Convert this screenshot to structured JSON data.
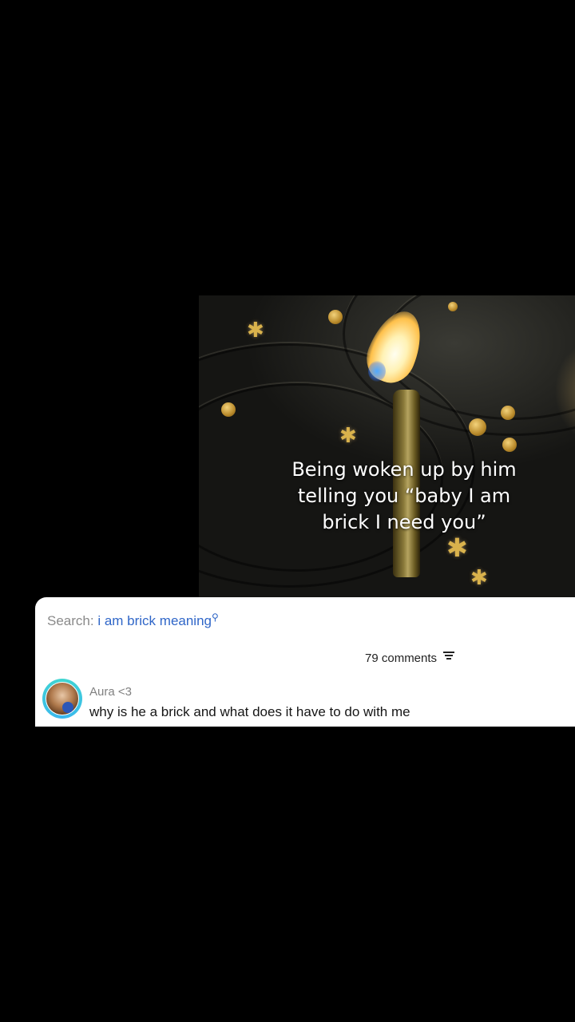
{
  "video": {
    "caption_lines": [
      "Being woken up by him",
      "telling you “baby I am",
      "brick I need you”"
    ]
  },
  "comments_panel": {
    "search_prefix": "Search:",
    "search_query": "i am brick meaning",
    "search_icon": "search-icon",
    "comment_count": "79 comments",
    "filter_icon": "filter-icon",
    "comments": [
      {
        "username": "Aura <3",
        "text": "why is he a brick and what does it have to do with me"
      }
    ]
  },
  "colors": {
    "background": "#000000",
    "search_link": "#2f66c8",
    "avatar_ring": "#40d6d0"
  }
}
